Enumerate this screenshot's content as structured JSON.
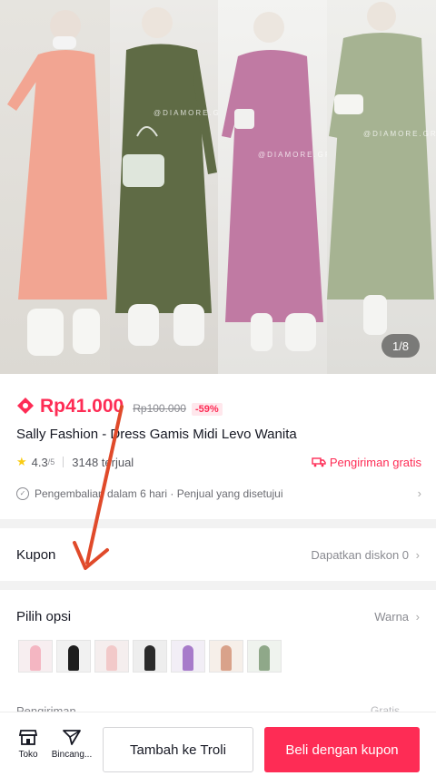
{
  "gallery": {
    "counter": "1/8",
    "watermark": "@DIAMORE.GR",
    "photo_colors": [
      "#f0a892",
      "#5f6b45",
      "#c07aa3",
      "#a6b392"
    ]
  },
  "product": {
    "price": "Rp41.000",
    "original_price": "Rp100.000",
    "discount": "-59%",
    "title": "Sally Fashion - Dress Gamis Midi Levo Wanita",
    "rating": "4.3",
    "rating_suffix": "/5",
    "sold": "3148 terjual",
    "shipping": "Pengiriman gratis",
    "policy": "Pengembalian dalam 6 hari · Penjual yang disetujui"
  },
  "coupon": {
    "title": "Kupon",
    "action": "Dapatkan diskon 0"
  },
  "options": {
    "title": "Pilih opsi",
    "action": "Warna",
    "swatches": [
      "#f4b6c2",
      "#1e1e1e",
      "#f2c9c9",
      "#2b2b2b",
      "#a77bca",
      "#d9a28a",
      "#8fa889"
    ],
    "next_row_label": "Pengiriman",
    "next_row_right": "Gratis"
  },
  "bottom_bar": {
    "shop_label": "Toko",
    "chat_label": "Bincang...",
    "cart_button": "Tambah ke Troli",
    "buy_button": "Beli dengan kupon"
  },
  "colors": {
    "accent": "#fe2c55",
    "annotation_arrow": "#e04a2a"
  }
}
